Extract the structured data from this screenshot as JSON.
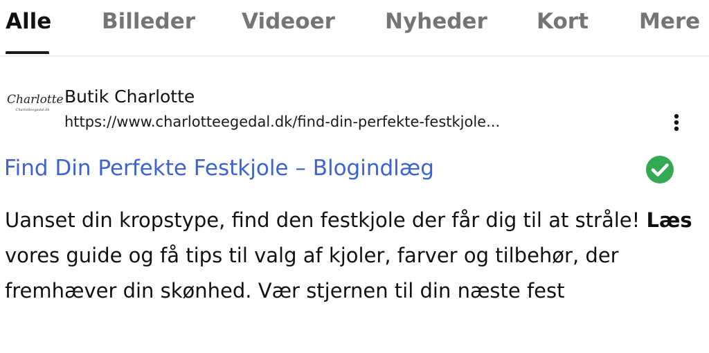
{
  "tabs": [
    {
      "label": "Alle",
      "active": true
    },
    {
      "label": "Billeder",
      "active": false
    },
    {
      "label": "Videoer",
      "active": false
    },
    {
      "label": "Nyheder",
      "active": false
    },
    {
      "label": "Kort",
      "active": false
    },
    {
      "label": "Mere",
      "active": false
    }
  ],
  "result": {
    "logo": {
      "script_text": "Charlotte",
      "small_text": "Charlotteegedal.dk"
    },
    "site_name": "Butik Charlotte",
    "url": "https://www.charlotteegedal.dk/find-din-perfekte-festkjole...",
    "more_icon": "three-dots-vertical-icon",
    "title": "Find Din Perfekte Festkjole – Blogindlæg",
    "verified_icon": "check-circle-icon",
    "snippet": {
      "part1": "Uanset din kropstype, find den festkjole der får dig til at stråle! ",
      "bold": "Læs",
      "part2": " vores guide og få tips til valg af kjoler, farver og tilbehør, der fremhæver din skønhed. Vær stjernen til din næste fest"
    }
  },
  "colors": {
    "link": "#3c63cf",
    "active_tab": "#111111",
    "inactive_tab": "#757575",
    "check": "#34a853"
  }
}
